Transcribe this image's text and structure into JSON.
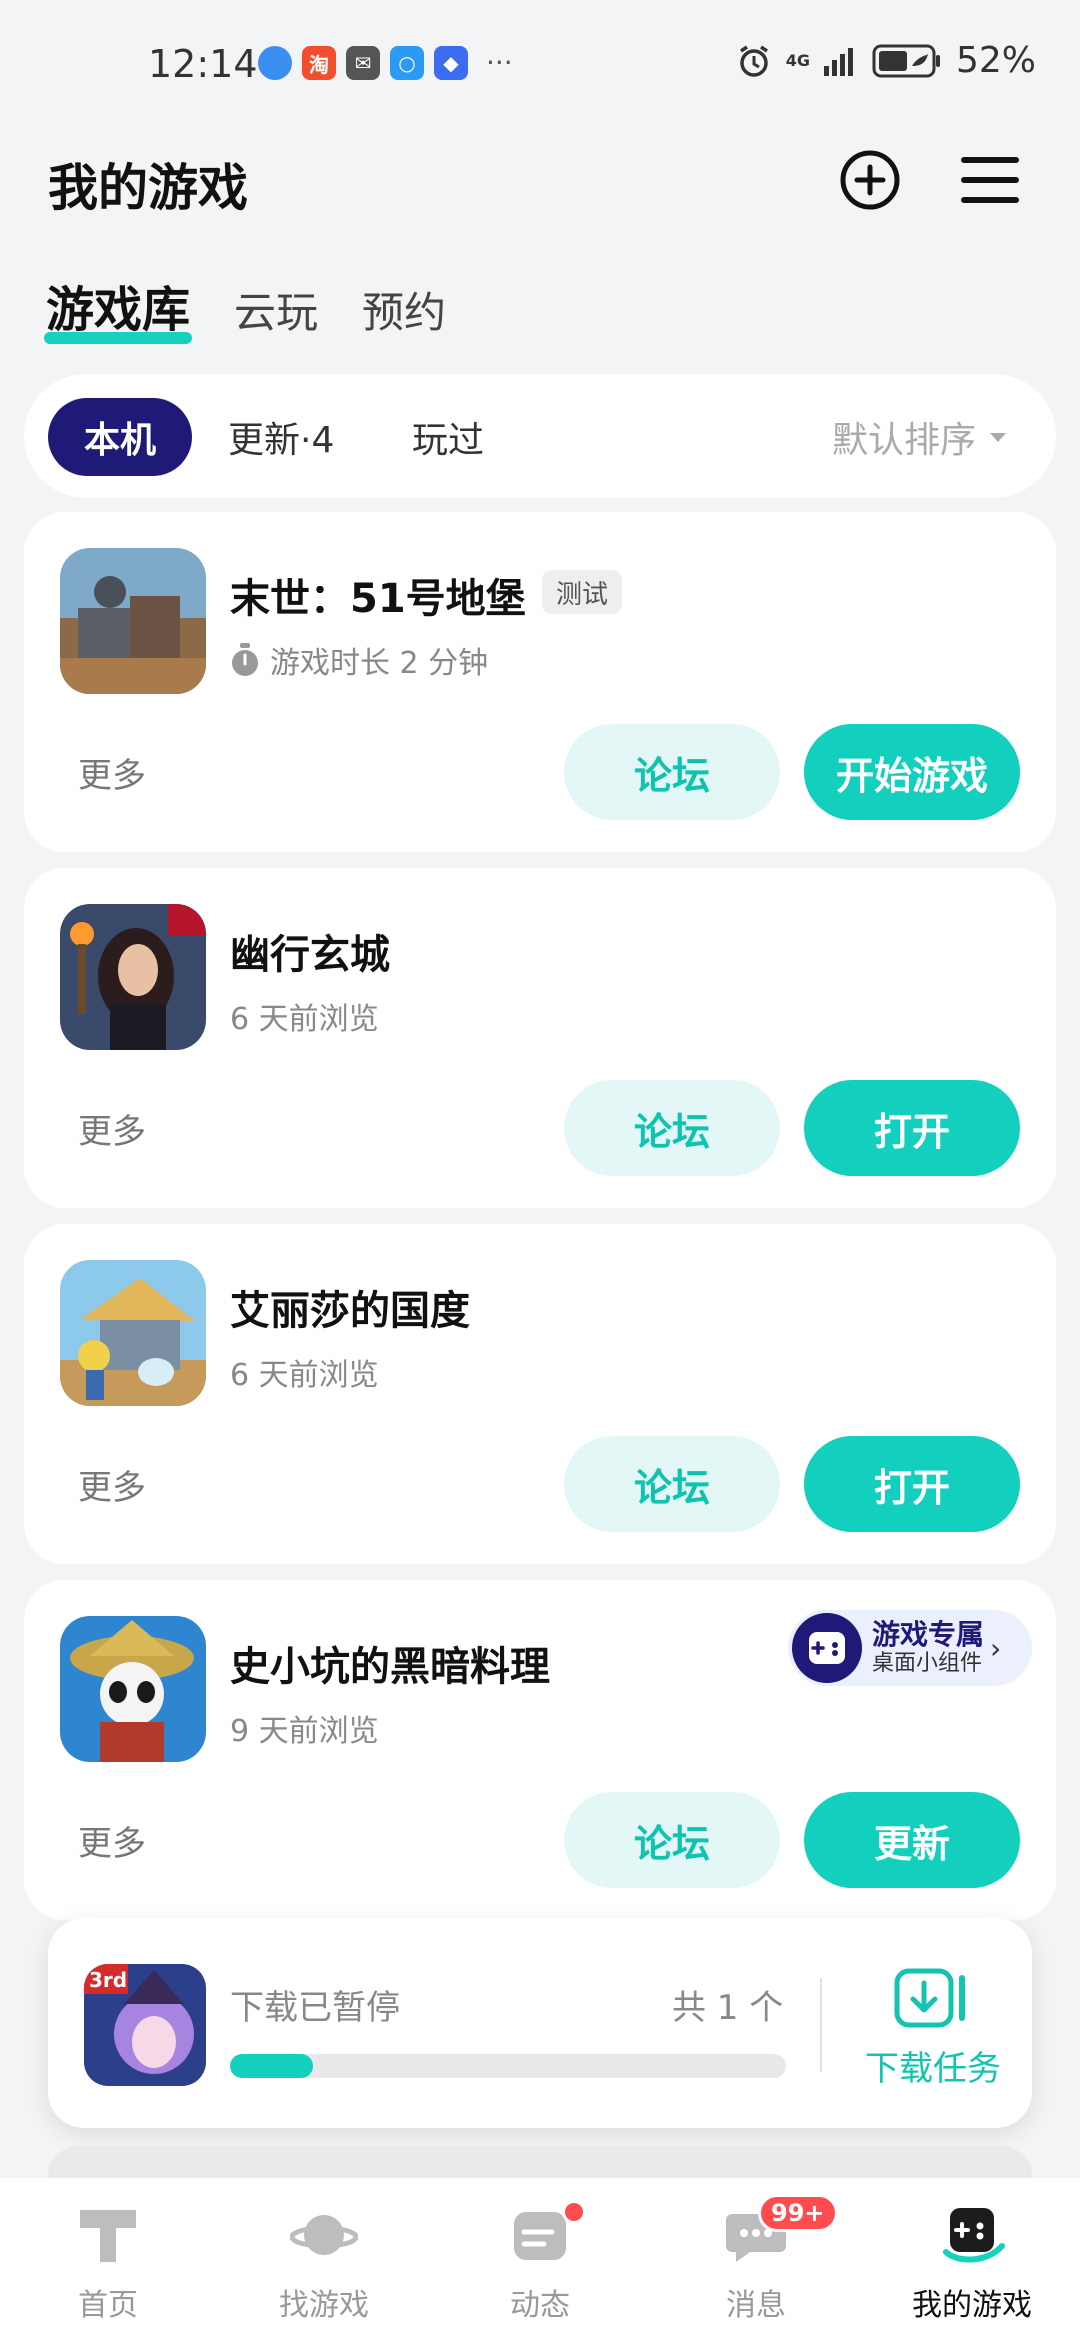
{
  "status_bar": {
    "time": "12:14",
    "network": "4G",
    "battery_percent": "52%",
    "overflow": "···"
  },
  "header": {
    "title": "我的游戏",
    "add_icon": "plus-circle-icon",
    "menu_icon": "hamburger-menu-icon"
  },
  "top_tabs": [
    {
      "label": "游戏库",
      "active": true
    },
    {
      "label": "云玩",
      "active": false
    },
    {
      "label": "预约",
      "active": false
    }
  ],
  "filters": {
    "local": "本机",
    "updates": "更新·4",
    "played": "玩过",
    "sort": "默认排序"
  },
  "games": [
    {
      "name": "末世：51号地堡",
      "tag": "测试",
      "subtitle": "游戏时长 2 分钟",
      "more": "更多",
      "forum": "论坛",
      "action": "开始游戏"
    },
    {
      "name": "幽行玄城",
      "subtitle": "6 天前浏览",
      "more": "更多",
      "forum": "论坛",
      "action": "打开"
    },
    {
      "name": "艾丽莎的国度",
      "subtitle": "6 天前浏览",
      "more": "更多",
      "forum": "论坛",
      "action": "打开"
    },
    {
      "name": "史小坑的黑暗料理",
      "subtitle": "9 天前浏览",
      "more": "更多",
      "forum": "论坛",
      "action": "更新",
      "widget": {
        "title": "游戏专属",
        "subtitle": "桌面小组件"
      }
    }
  ],
  "download": {
    "status": "下载已暂停",
    "count": "共 1 个",
    "progress": 0.15,
    "tasks_label": "下载任务",
    "icon_badge": "3rd"
  },
  "bottom_nav": [
    {
      "label": "首页",
      "icon": "home-icon"
    },
    {
      "label": "找游戏",
      "icon": "planet-icon"
    },
    {
      "label": "动态",
      "icon": "feed-icon"
    },
    {
      "label": "消息",
      "icon": "chat-icon",
      "badge": "99+"
    },
    {
      "label": "我的游戏",
      "icon": "gamepad-icon",
      "active": true
    }
  ],
  "colors": {
    "accent": "#12d0bd",
    "brand_dark": "#1f1a78",
    "badge_red": "#ff4d4f"
  }
}
